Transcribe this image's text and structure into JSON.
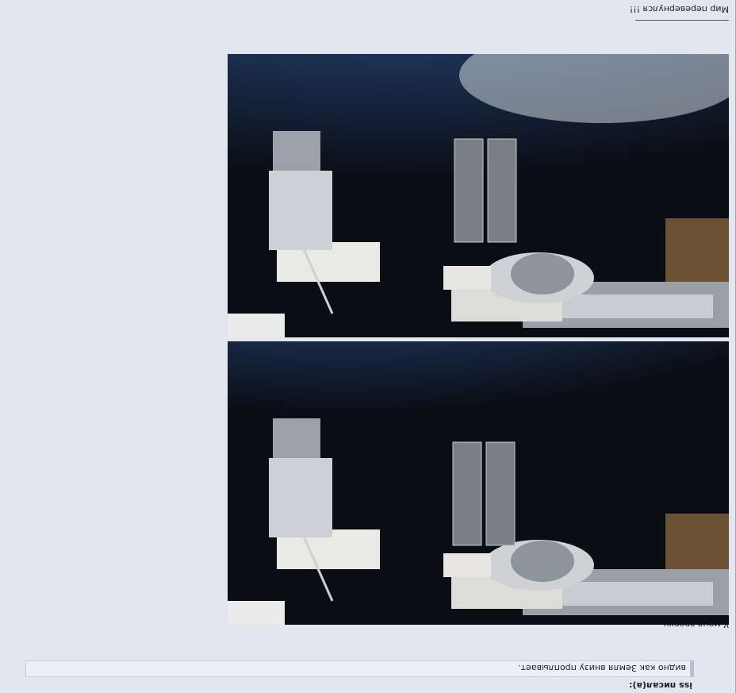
{
  "post": {
    "quote_author": "iss писал(а):",
    "quote_text": "видно как Земля внизу проплывает.",
    "reply_caption": "У меня вверху.",
    "footer_text": "Мир перевернулся !!!"
  },
  "images": [
    {
      "name": "iss-photo-upper",
      "description": "ISS view"
    },
    {
      "name": "iss-photo-lower",
      "description": "ISS view"
    }
  ],
  "colors": {
    "page_bg": "#e2e7ef",
    "quote_bg": "#eceff4",
    "quote_border": "#b8bfcc",
    "space": "#0a0d14",
    "earth": "#2d4a78"
  }
}
